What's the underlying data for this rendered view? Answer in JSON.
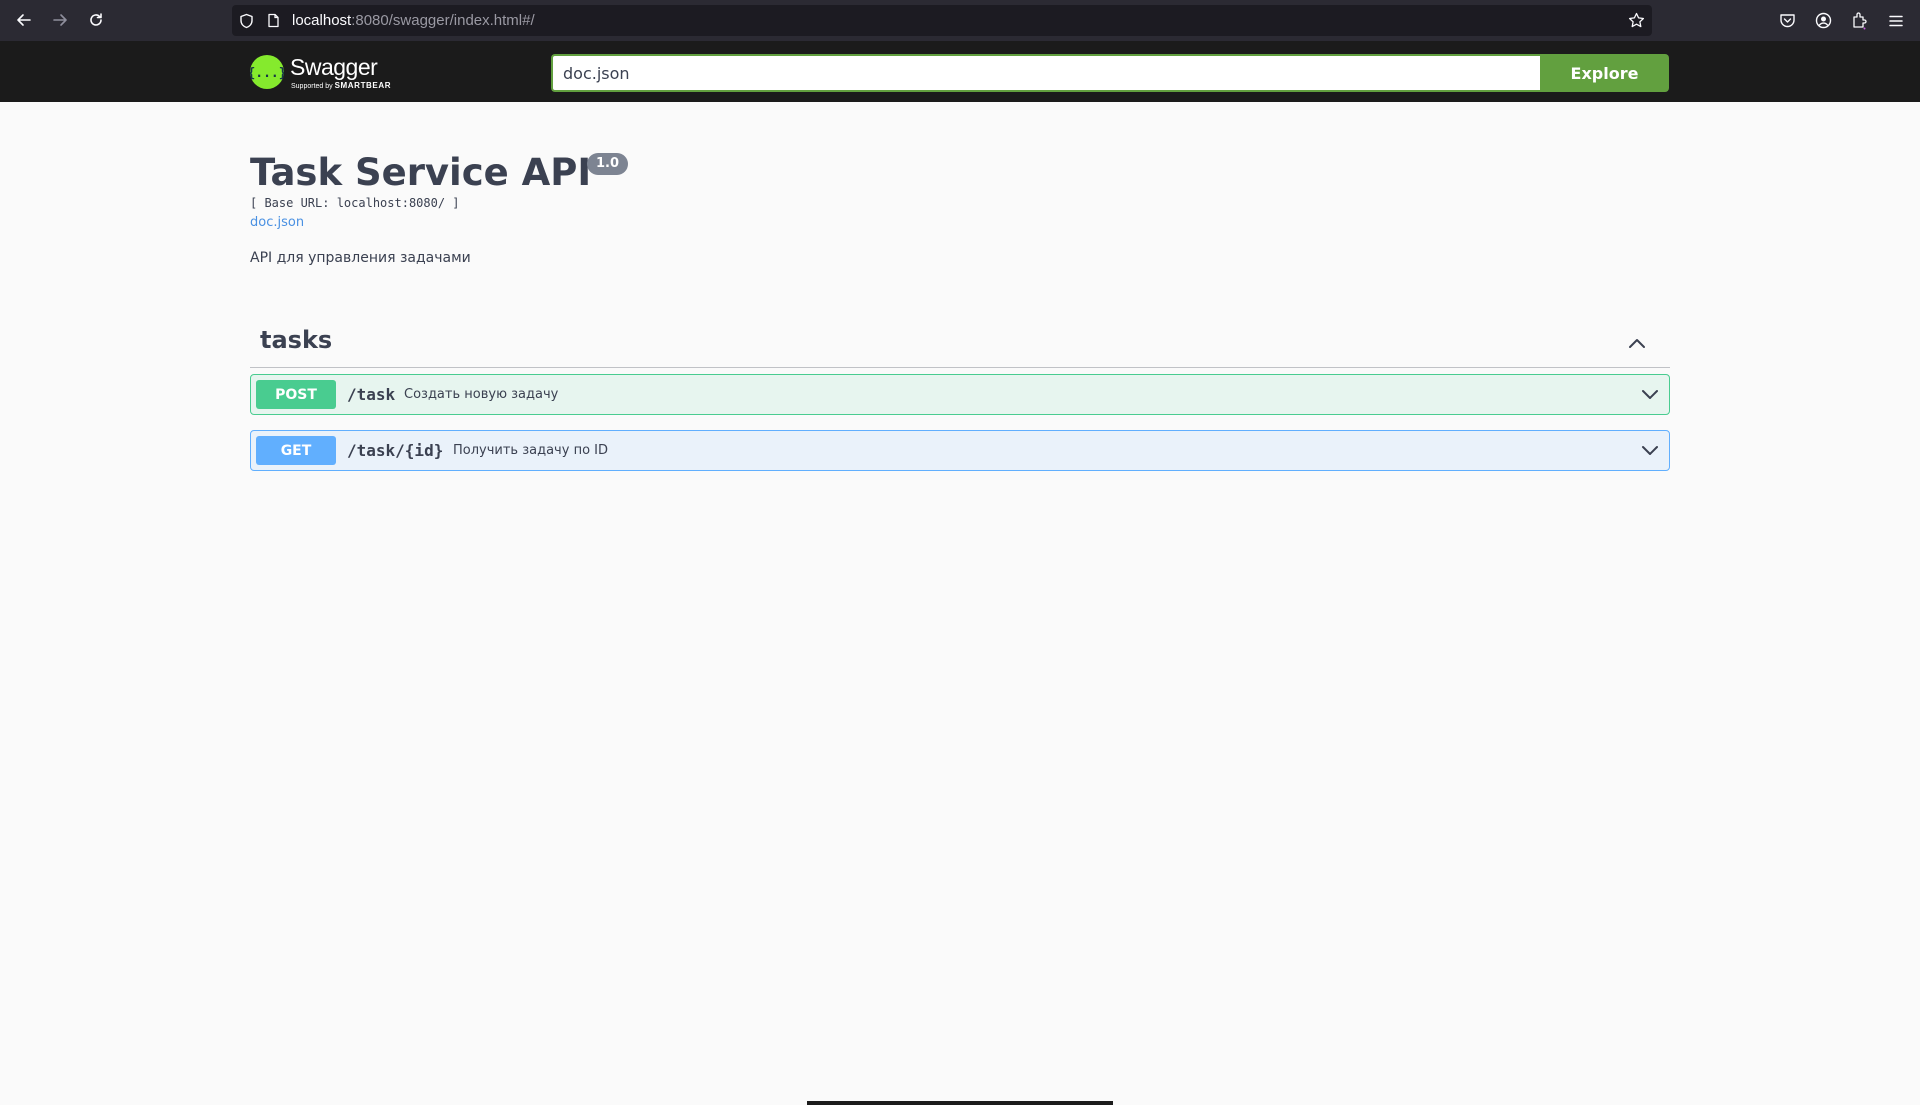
{
  "browser": {
    "url_host": "localhost",
    "url_rest": ":8080/swagger/index.html#/",
    "icons": [
      "back-arrow-icon",
      "forward-arrow-icon",
      "reload-icon",
      "shield-icon",
      "page-icon",
      "star-icon",
      "pocket-icon",
      "account-icon",
      "extensions-icon",
      "menu-icon"
    ]
  },
  "topbar": {
    "logo_title": "Swagger",
    "logo_sub_prefix": "Supported by",
    "logo_sub_brand": "SMARTBEAR",
    "spec_url_value": "doc.json",
    "explore_label": "Explore",
    "accent_color": "#62a03f"
  },
  "info": {
    "title": "Task Service API",
    "version": "1.0",
    "base_url": "[ Base URL: localhost:8080/ ]",
    "spec_link": "doc.json",
    "description": "API для управления задачами"
  },
  "tags": [
    {
      "name": "tasks",
      "expanded": true,
      "operations": [
        {
          "method": "POST",
          "path": "/task",
          "summary": "Создать новую задачу",
          "color": "#49cc90"
        },
        {
          "method": "GET",
          "path": "/task/{id}",
          "summary": "Получить задачу по ID",
          "color": "#61affe"
        }
      ]
    }
  ]
}
